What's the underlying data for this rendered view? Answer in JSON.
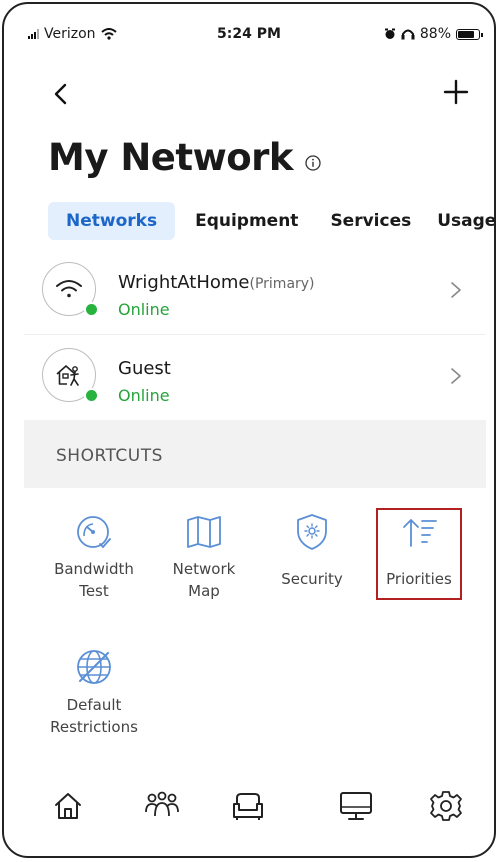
{
  "status_bar": {
    "carrier": "Verizon",
    "time": "5:24 PM",
    "battery": "88%",
    "battery_level": 0.88
  },
  "header": {
    "title": "My Network",
    "back_icon": "chevron-left-icon",
    "add_icon": "plus-icon",
    "info_icon": "info-icon"
  },
  "tabs": [
    {
      "label": "Networks",
      "active": true
    },
    {
      "label": "Equipment",
      "active": false
    },
    {
      "label": "Services",
      "active": false
    },
    {
      "label": "Usage",
      "active": false
    }
  ],
  "networks": [
    {
      "name": "WrightAtHome",
      "tag": "(Primary)",
      "status": "Online",
      "icon": "wifi-icon"
    },
    {
      "name": "Guest",
      "tag": "",
      "status": "Online",
      "icon": "guest-icon"
    }
  ],
  "shortcuts": {
    "heading": "SHORTCUTS",
    "items": [
      {
        "line1": "Bandwidth",
        "line2": "Test",
        "icon": "speedometer-icon"
      },
      {
        "line1": "Network",
        "line2": "Map",
        "icon": "map-icon"
      },
      {
        "line1": "Security",
        "line2": "",
        "icon": "shield-icon"
      },
      {
        "line1": "Priorities",
        "line2": "",
        "icon": "priorities-icon",
        "highlighted": true
      },
      {
        "line1": "Default",
        "line2": "Restrictions",
        "icon": "globe-restricted-icon"
      }
    ]
  },
  "bottom_nav": [
    {
      "icon": "home-icon"
    },
    {
      "icon": "people-icon"
    },
    {
      "icon": "sofa-icon"
    },
    {
      "icon": "monitor-icon"
    },
    {
      "icon": "settings-icon"
    }
  ],
  "colors": {
    "accent": "#1d66c9",
    "accent_bg": "#e3effd",
    "online": "#27a33a",
    "shortcut_icon": "#5b8fd6",
    "highlight_border": "#b32020"
  }
}
